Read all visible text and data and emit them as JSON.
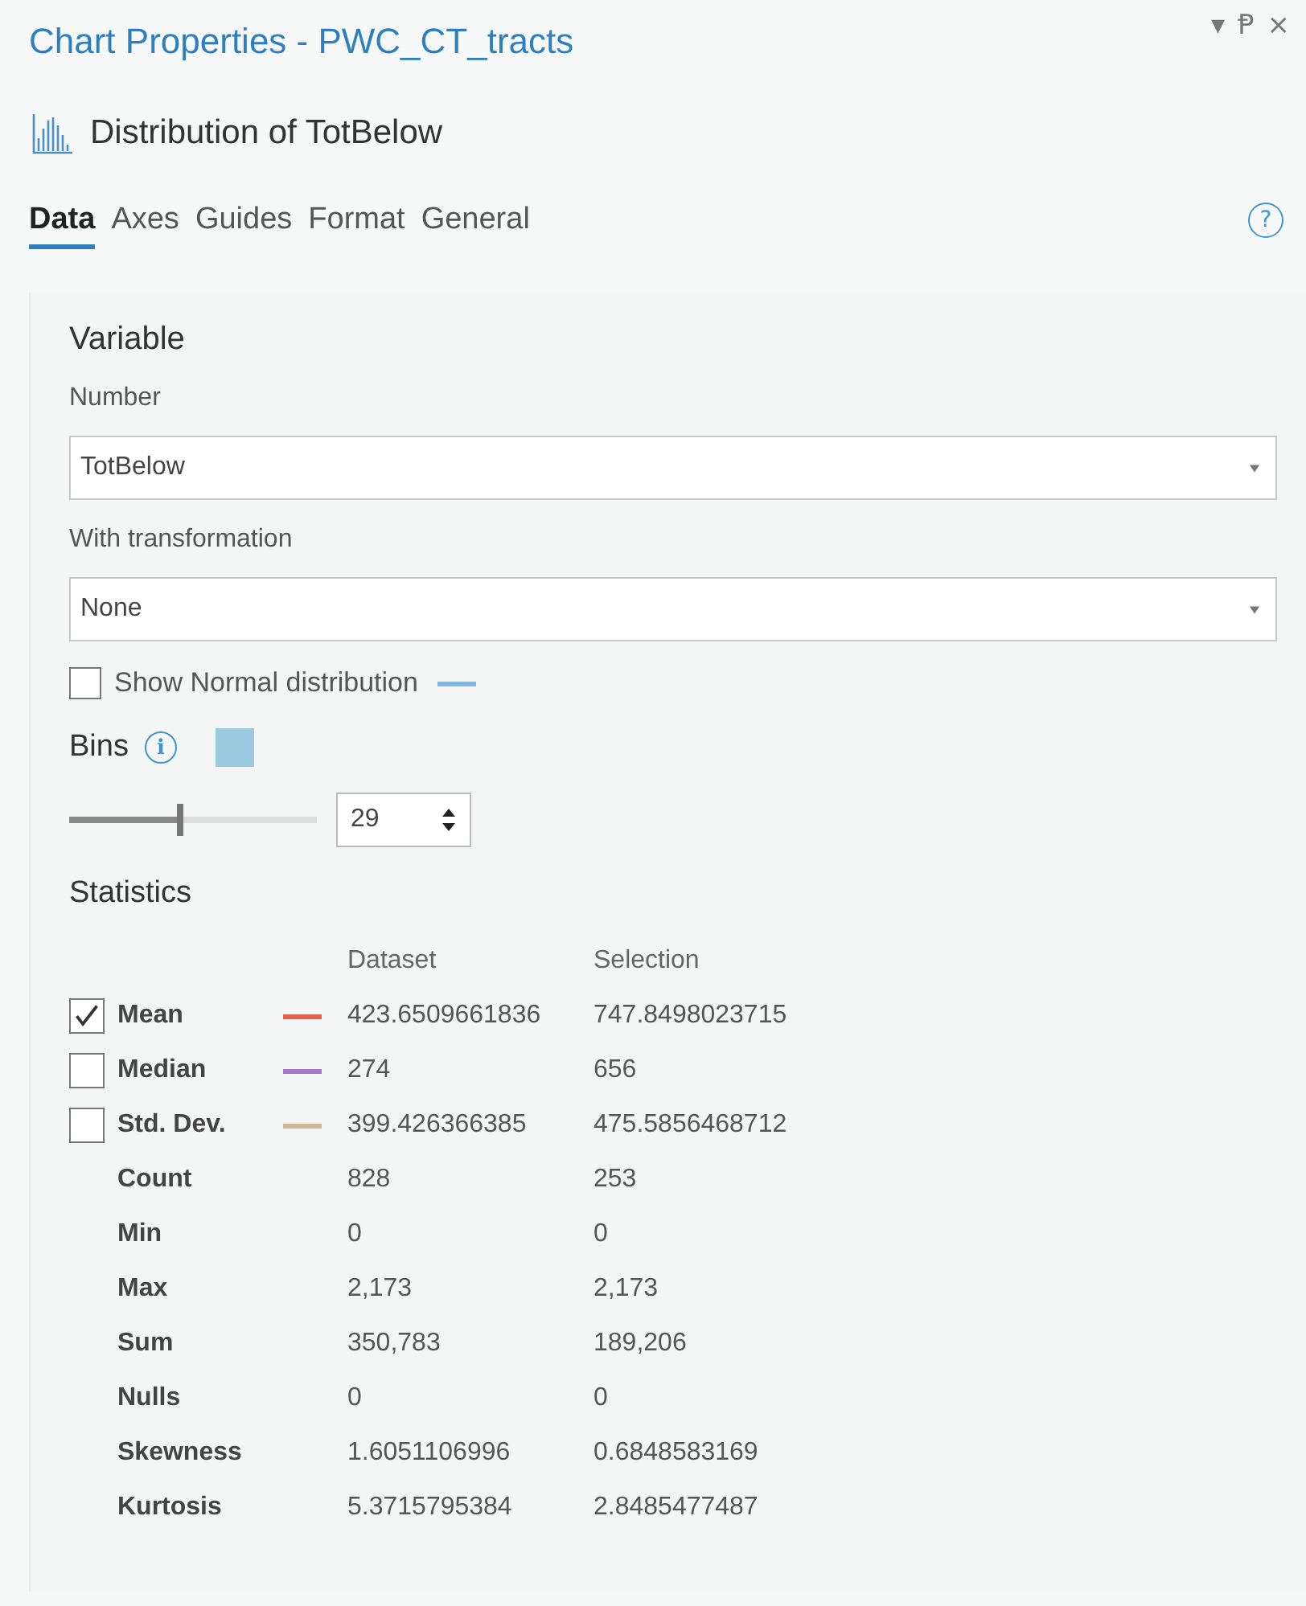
{
  "window": {
    "title": "Chart Properties - PWC_CT_tracts",
    "controls": [
      "▾",
      "Ᵽ",
      "×"
    ]
  },
  "chart_title": "Distribution of TotBelow",
  "tabs": [
    {
      "label": "Data",
      "selected": true
    },
    {
      "label": "Axes",
      "selected": false
    },
    {
      "label": "Guides",
      "selected": false
    },
    {
      "label": "Format",
      "selected": false
    },
    {
      "label": "General",
      "selected": false
    }
  ],
  "help": "?",
  "variable": {
    "heading": "Variable",
    "number_label": "Number",
    "number_value": "TotBelow",
    "transformation_label": "With transformation",
    "transformation_value": "None"
  },
  "normal_distribution": {
    "label": "Show Normal distribution",
    "checked": false,
    "color": "#7fb8dc"
  },
  "bins": {
    "label": "Bins",
    "info": "i",
    "color": "#9cc9e2",
    "level": 0.45,
    "value": "29"
  },
  "statistics": {
    "heading": "Statistics",
    "columns": [
      "Dataset",
      "Selection"
    ],
    "rows": [
      {
        "kind": "checkable",
        "label": "Mean",
        "checked": true,
        "color": "#e8604c",
        "dataset": "423.6509661836",
        "selection": "747.8498023715"
      },
      {
        "kind": "checkable",
        "label": "Median",
        "checked": false,
        "color": "#a678c8",
        "dataset": "274",
        "selection": "656"
      },
      {
        "kind": "checkable",
        "label": "Std. Dev.",
        "checked": false,
        "color": "#d2b896",
        "dataset": "399.426366385",
        "selection": "475.5856468712"
      },
      {
        "kind": "plain",
        "label": "Count",
        "dataset": "828",
        "selection": "253"
      },
      {
        "kind": "plain",
        "label": "Min",
        "dataset": "0",
        "selection": "0"
      },
      {
        "kind": "plain",
        "label": "Max",
        "dataset": "2,173",
        "selection": "2,173"
      },
      {
        "kind": "plain",
        "label": "Sum",
        "dataset": "350,783",
        "selection": "189,206"
      },
      {
        "kind": "plain",
        "label": "Nulls",
        "dataset": "0",
        "selection": "0"
      },
      {
        "kind": "plain",
        "label": "Skewness",
        "dataset": "1.6051106996",
        "selection": "0.6848583169"
      },
      {
        "kind": "plain",
        "label": "Kurtosis",
        "dataset": "5.3715795384",
        "selection": "2.8485477487"
      }
    ]
  }
}
